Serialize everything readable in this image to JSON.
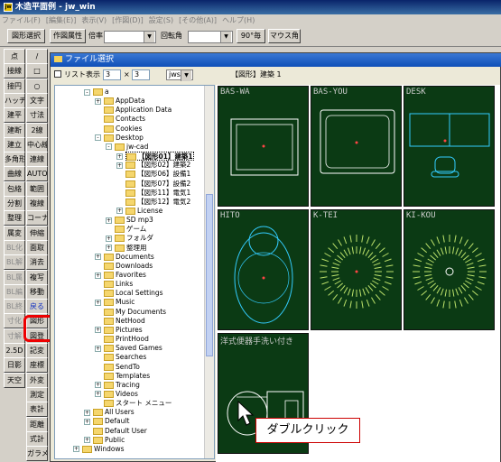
{
  "window": {
    "title": "木造平面例 - jw_win"
  },
  "menubar": [
    "ファイル(F)",
    "[編集(E)]",
    "表示(V)",
    "[作図(D)]",
    "設定(S)",
    "[その他(A)]",
    "ヘルプ(H)"
  ],
  "toolbar": {
    "select_figure": "図形選択",
    "attrs": "作図属性",
    "scale_label": "倍率",
    "rotation_label": "回転角",
    "deg90": "90°毎",
    "mouse_angle": "マウス角"
  },
  "side_left": [
    "点",
    "接線",
    "接円",
    "ハッチ",
    "建平",
    "建断",
    "建立",
    "多角形",
    "曲線",
    "包絡",
    "分割",
    "整理",
    "属変",
    "BL化",
    "BL解",
    "BL属",
    "BL編",
    "BL終",
    "寸化",
    "寸解",
    "2.5D",
    "日影",
    "天空"
  ],
  "side_right": [
    "/",
    "□",
    "○",
    "文字",
    "寸法",
    "2線",
    "中心線",
    "連線",
    "AUTO",
    "範囲",
    "複線",
    "コーナー",
    "伸縮",
    "面取",
    "消去",
    "複写",
    "移動",
    "戻る",
    "図形",
    "図登",
    "記変",
    "座標",
    "外変",
    "測定",
    "表計",
    "距離",
    "式計",
    "ガラメ"
  ],
  "dialog": {
    "title": "ファイル選択",
    "list_view_label": "リスト表示",
    "cols": "3",
    "rows": "3",
    "ext": "jws",
    "folder_label": "【図形】建築 1",
    "tree": [
      {
        "t": "a",
        "d": 1,
        "e": "-"
      },
      {
        "t": "AppData",
        "d": 2,
        "e": "+"
      },
      {
        "t": "Application Data",
        "d": 2,
        "e": ""
      },
      {
        "t": "Contacts",
        "d": 2,
        "e": ""
      },
      {
        "t": "Cookies",
        "d": 2,
        "e": ""
      },
      {
        "t": "Desktop",
        "d": 2,
        "e": "-"
      },
      {
        "t": "jw-cad",
        "d": 3,
        "e": "-"
      },
      {
        "t": "【図形01】建築1",
        "d": 4,
        "e": "+",
        "sel": true
      },
      {
        "t": "【図形02】建築2",
        "d": 4,
        "e": "+"
      },
      {
        "t": "【図形06】設備1",
        "d": 4,
        "e": ""
      },
      {
        "t": "【図形07】設備2",
        "d": 4,
        "e": ""
      },
      {
        "t": "【図形11】電気1",
        "d": 4,
        "e": ""
      },
      {
        "t": "【図形12】電気2",
        "d": 4,
        "e": ""
      },
      {
        "t": "License",
        "d": 4,
        "e": "+"
      },
      {
        "t": "SD mp3",
        "d": 3,
        "e": "+"
      },
      {
        "t": "ゲーム",
        "d": 3,
        "e": ""
      },
      {
        "t": "フォルダ",
        "d": 3,
        "e": "+"
      },
      {
        "t": "整理用",
        "d": 3,
        "e": "+"
      },
      {
        "t": "Documents",
        "d": 2,
        "e": "+"
      },
      {
        "t": "Downloads",
        "d": 2,
        "e": ""
      },
      {
        "t": "Favorites",
        "d": 2,
        "e": "+"
      },
      {
        "t": "Links",
        "d": 2,
        "e": ""
      },
      {
        "t": "Local Settings",
        "d": 2,
        "e": ""
      },
      {
        "t": "Music",
        "d": 2,
        "e": "+"
      },
      {
        "t": "My Documents",
        "d": 2,
        "e": ""
      },
      {
        "t": "NetHood",
        "d": 2,
        "e": ""
      },
      {
        "t": "Pictures",
        "d": 2,
        "e": "+"
      },
      {
        "t": "PrintHood",
        "d": 2,
        "e": ""
      },
      {
        "t": "Saved Games",
        "d": 2,
        "e": "+"
      },
      {
        "t": "Searches",
        "d": 2,
        "e": ""
      },
      {
        "t": "SendTo",
        "d": 2,
        "e": ""
      },
      {
        "t": "Templates",
        "d": 2,
        "e": ""
      },
      {
        "t": "Tracing",
        "d": 2,
        "e": "+"
      },
      {
        "t": "Videos",
        "d": 2,
        "e": "+"
      },
      {
        "t": "スタート メニュー",
        "d": 2,
        "e": ""
      },
      {
        "t": "All Users",
        "d": 1,
        "e": "+"
      },
      {
        "t": "Default",
        "d": 1,
        "e": "+"
      },
      {
        "t": "Default User",
        "d": 1,
        "e": ""
      },
      {
        "t": "Public",
        "d": 1,
        "e": "+"
      },
      {
        "t": "Windows",
        "d": 0,
        "e": "+"
      }
    ],
    "tiles": [
      "BAS-WA",
      "BAS-YOU",
      "DESK",
      "HITO",
      "K-TEI",
      "KI-KOU",
      "洋式便器手洗い付き"
    ]
  },
  "callout": "ダブルクリック"
}
